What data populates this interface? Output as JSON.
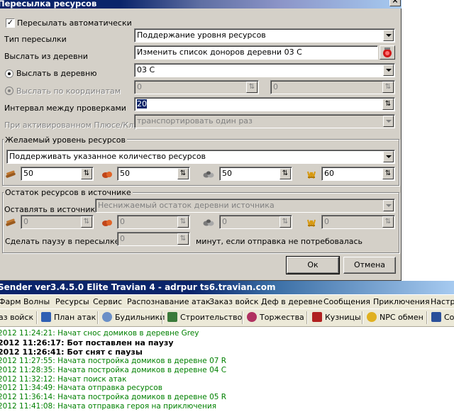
{
  "dialog": {
    "title": "Пересылка ресурсов",
    "close_glyph": "×",
    "auto_send_label": "Пересылать автоматически",
    "send_type_label": "Тип пересылки",
    "send_type_value": "Поддержание уровня ресурсов",
    "send_from_label": "Выслать из деревни",
    "send_from_value": "Изменить список доноров деревни 03 С",
    "send_to_village_label": "Выслать в деревню",
    "send_to_village_value": "03 С",
    "send_to_coords_label": "Выслать по координатам",
    "coord_x": "0",
    "coord_y": "0",
    "interval_label": "Интервал между проверками",
    "interval_value": "20",
    "plus_club_label": "При активированном Плюсе/Клубе",
    "plus_club_value": "транспортировать один раз",
    "desired": {
      "title": "Желаемый уровень ресурсов",
      "mode_value": "Поддерживать указанное количество ресурсов",
      "wood": "50",
      "clay": "50",
      "iron": "50",
      "crop": "60"
    },
    "remainder": {
      "title": "Остаток ресурсов в источнике",
      "leave_label": "Оставлять в источнике",
      "leave_value": "Неснижаемый остаток деревни источника",
      "wood": "0",
      "clay": "0",
      "iron": "0",
      "crop": "0"
    },
    "pause_label": "Сделать паузу в пересылке",
    "pause_value": "0",
    "pause_suffix": "минут, если отправка не потребовалась",
    "ok_label": "Ок",
    "cancel_label": "Отмена"
  },
  "main_window": {
    "title": "Sender ver3.4.5.0 Elite Travian 4 - adrpur ts6.travian.com",
    "menu": [
      "Фарм",
      "Волны",
      "Ресурсы",
      "Сервис",
      "Распознавание атак",
      "Заказ войск",
      "Деф в деревне",
      "Сообщения",
      "Приключения",
      "Настр"
    ],
    "toolbar": [
      "аз войск",
      "План атак",
      "Будильники",
      "Строительство",
      "Торжества",
      "Кузницы",
      "NPC обмен",
      "Со"
    ],
    "log": [
      {
        "text": "2012 11:24:21: Начат снос домиков в деревне Grey",
        "color": "#008000",
        "bold": false
      },
      {
        "text": "2012 11:26:17: Бот поставлен на паузу",
        "color": "#000000",
        "bold": true
      },
      {
        "text": "2012 11:26:41: Бот снят с паузы",
        "color": "#000000",
        "bold": true
      },
      {
        "text": "2012 11:27:55: Начата постройка домиков в деревне 07 R",
        "color": "#008000",
        "bold": false
      },
      {
        "text": "2012 11:28:35: Начата постройка домиков в деревне 04 С",
        "color": "#008000",
        "bold": false
      },
      {
        "text": "2012 11:32:12: Начат поиск атак",
        "color": "#008000",
        "bold": false
      },
      {
        "text": "2012 11:34:49: Начата отправка ресурсов",
        "color": "#008000",
        "bold": false
      },
      {
        "text": "2012 11:36:14: Начата постройка домиков в деревне 05 R",
        "color": "#008000",
        "bold": false
      },
      {
        "text": "2012 11:41:08: Начата отправка героя на приключения",
        "color": "#008000",
        "bold": false
      }
    ]
  },
  "colors": {
    "dialog_face": "#d4d0c8",
    "titlebar": "#0a246a",
    "log_green": "#008000"
  },
  "icons": [
    "wood-icon",
    "clay-icon",
    "iron-icon",
    "crop-icon",
    "donor-list-icon",
    "spinner-icon",
    "dropdown-arrow-icon"
  ]
}
